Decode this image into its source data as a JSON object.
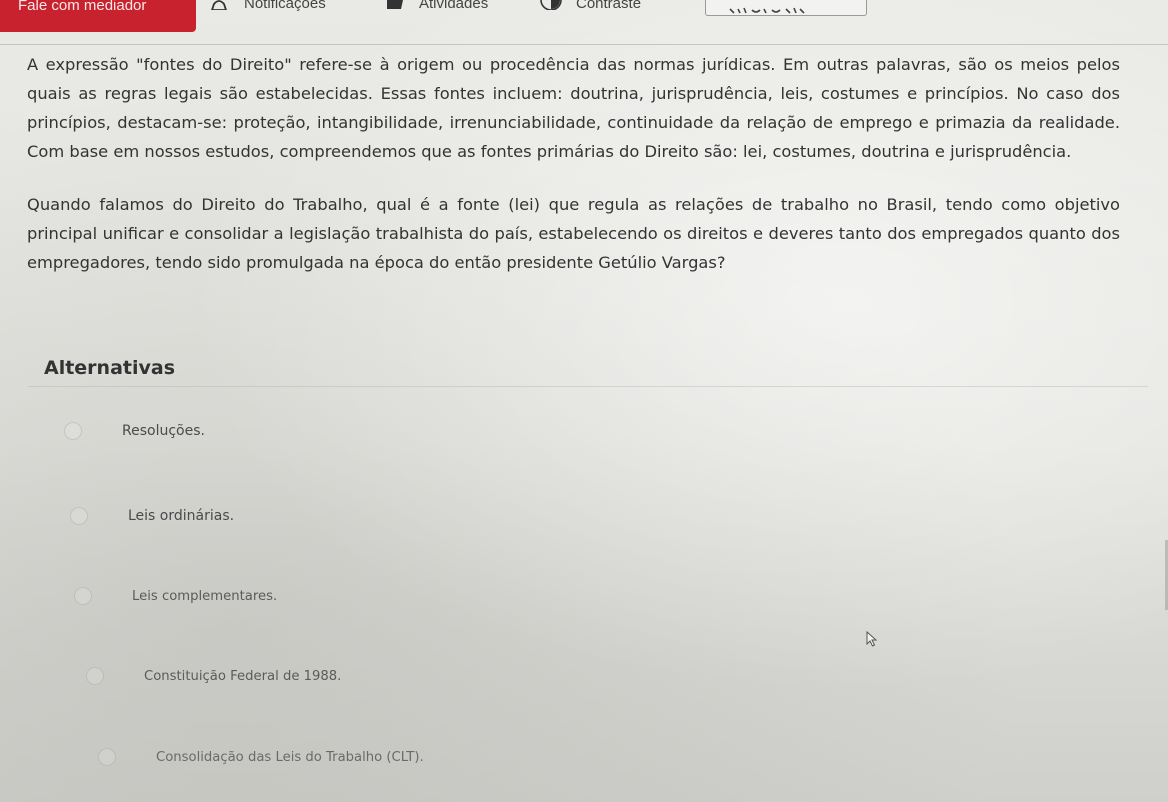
{
  "toolbar": {
    "mediator_label": "Fale com mediador",
    "notifications_label": "Notificações",
    "activities_label": "Atividades",
    "contrast_label": "Contraste",
    "icons": {
      "notifications": "bell-icon",
      "activities": "activities-icon",
      "contrast": "contrast-icon",
      "audio": "audio-player-icon"
    },
    "accent_color": "#c7222e"
  },
  "question": {
    "paragraph_1": "A expressão \"fontes do Direito\" refere-se à origem ou procedência das normas jurídicas. Em outras palavras, são os meios pelos quais as regras legais são estabelecidas. Essas fontes incluem: doutrina, jurisprudência, leis, costumes e princípios. No caso dos princípios, destacam-se: proteção, intangibilidade, irrenunciabilidade, continuidade da relação de emprego e primazia da realidade. Com base em nossos estudos, compreendemos que as fontes primárias do Direito são: lei, costumes, doutrina e jurisprudência.",
    "paragraph_2": "Quando falamos do Direito do Trabalho, qual é a fonte (lei) que regula as relações de trabalho no Brasil, tendo como objetivo principal unificar e consolidar a legislação trabalhista do país, estabelecendo os direitos e deveres tanto dos empregados quanto dos empregadores, tendo sido promulgada na época do então presidente Getúlio Vargas?"
  },
  "alternatives": {
    "title": "Alternativas",
    "options": [
      {
        "label": "Resoluções."
      },
      {
        "label": "Leis ordinárias."
      },
      {
        "label": "Leis complementares."
      },
      {
        "label": "Constituição Federal de 1988."
      },
      {
        "label": "Consolidação das Leis do Trabalho (CLT)."
      }
    ]
  }
}
